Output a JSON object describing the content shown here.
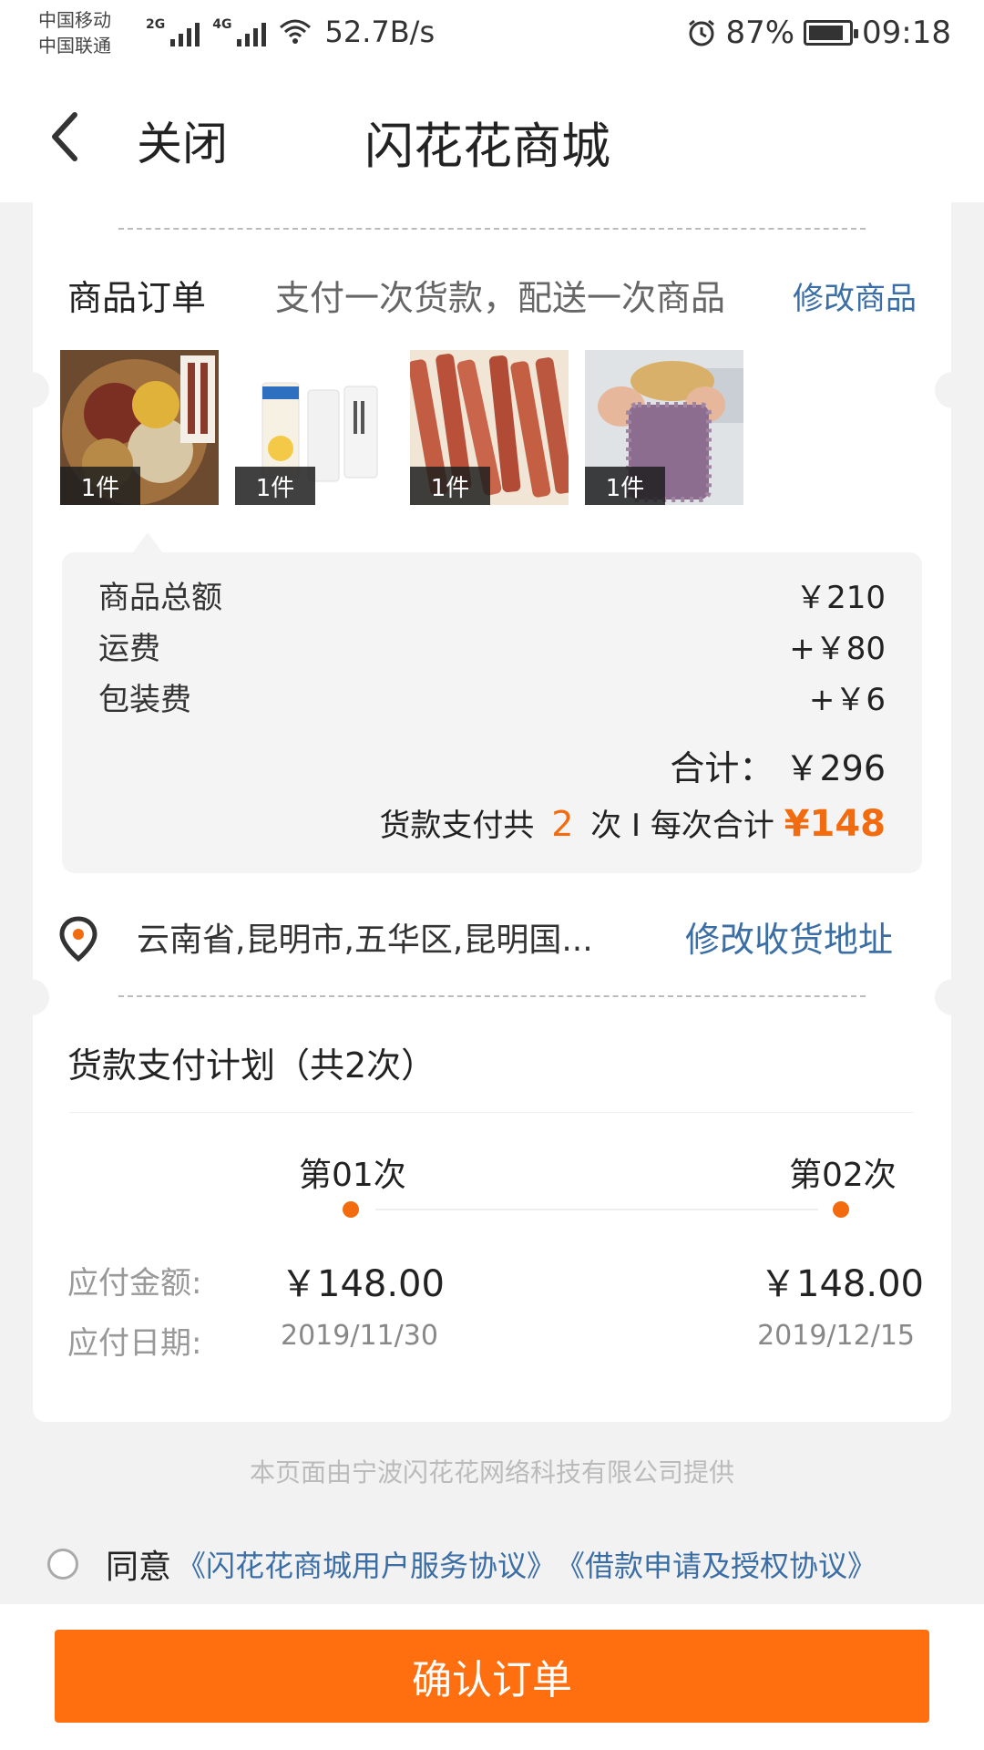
{
  "status_bar": {
    "carrier_1": "中国移动",
    "carrier_2": "中国联通",
    "sig_2g": "2G",
    "sig_4g": "4G",
    "net_speed": "52.7B/s",
    "battery": "87%",
    "battery_level": 0.87,
    "time": "09:18"
  },
  "header": {
    "back_icon": "chevron-left-icon",
    "close_label": "关闭",
    "title": "闪花花商城"
  },
  "order": {
    "title": "商品订单",
    "description": "支付一次货款，配送一次商品",
    "edit_label": "修改商品",
    "items": [
      {
        "qty": "1件",
        "image": "grain-food-photo"
      },
      {
        "qty": "1件",
        "image": "skincare-tubes-photo"
      },
      {
        "qty": "1件",
        "image": "dried-sausage-photo"
      },
      {
        "qty": "1件",
        "image": "cleaning-cloth-photo"
      }
    ]
  },
  "summary": {
    "rows": [
      {
        "label": "商品总额",
        "value": "￥210"
      },
      {
        "label": "运费",
        "value": "+￥80"
      },
      {
        "label": "包装费",
        "value": "+￥6"
      }
    ],
    "total_label": "合计：",
    "total_value": "￥296",
    "installment_prefix": "货款支付共",
    "installment_count": "2",
    "installment_mid": "次 I 每次合计",
    "installment_amount": "¥148"
  },
  "address": {
    "icon": "location-pin-icon",
    "text": "云南省,昆明市,五华区,昆明国...",
    "edit_label": "修改收货地址"
  },
  "plan": {
    "title": "货款支付计划（共2次）",
    "amount_label": "应付金额:",
    "date_label": "应付日期:",
    "payments": [
      {
        "label": "第01次",
        "amount": "￥148.00",
        "date": "2019/11/30"
      },
      {
        "label": "第02次",
        "amount": "￥148.00",
        "date": "2019/12/15"
      }
    ]
  },
  "footer_note": "本页面由宁波闪花花网络科技有限公司提供",
  "agreement": {
    "agree_label": "同意",
    "link_1": "《闪花花商城用户服务协议》",
    "link_2": "《借款申请及授权协议》"
  },
  "confirm_button": "确认订单",
  "colors": {
    "accent": "#ff6f0f",
    "link": "#3b6ea5",
    "background": "#f2f2f2"
  }
}
